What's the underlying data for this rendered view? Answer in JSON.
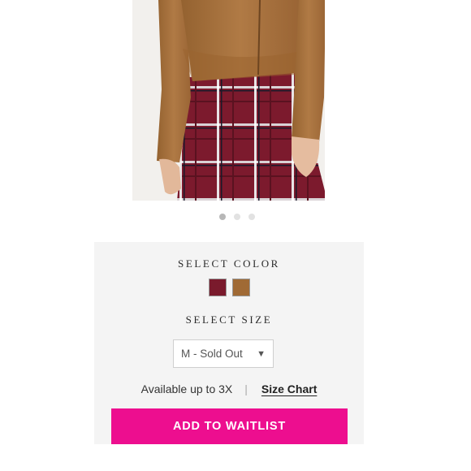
{
  "product": {
    "image_alt": "Model wearing a tan suede jacket and burgundy plaid skirt",
    "carousel": {
      "count": 3,
      "active_index": 0
    }
  },
  "options": {
    "color_label": "SELECT COLOR",
    "colors": [
      {
        "name": "burgundy",
        "hex": "#7a1a2c"
      },
      {
        "name": "tan",
        "hex": "#a06a35"
      }
    ],
    "size_label": "SELECT SIZE",
    "size_select": {
      "value": "M - Sold Out"
    },
    "availability": "Available up to 3X",
    "separator": "|",
    "size_chart_link": "Size Chart"
  },
  "cta": {
    "label": "ADD TO WAITLIST",
    "color": "#ed0e8f"
  }
}
